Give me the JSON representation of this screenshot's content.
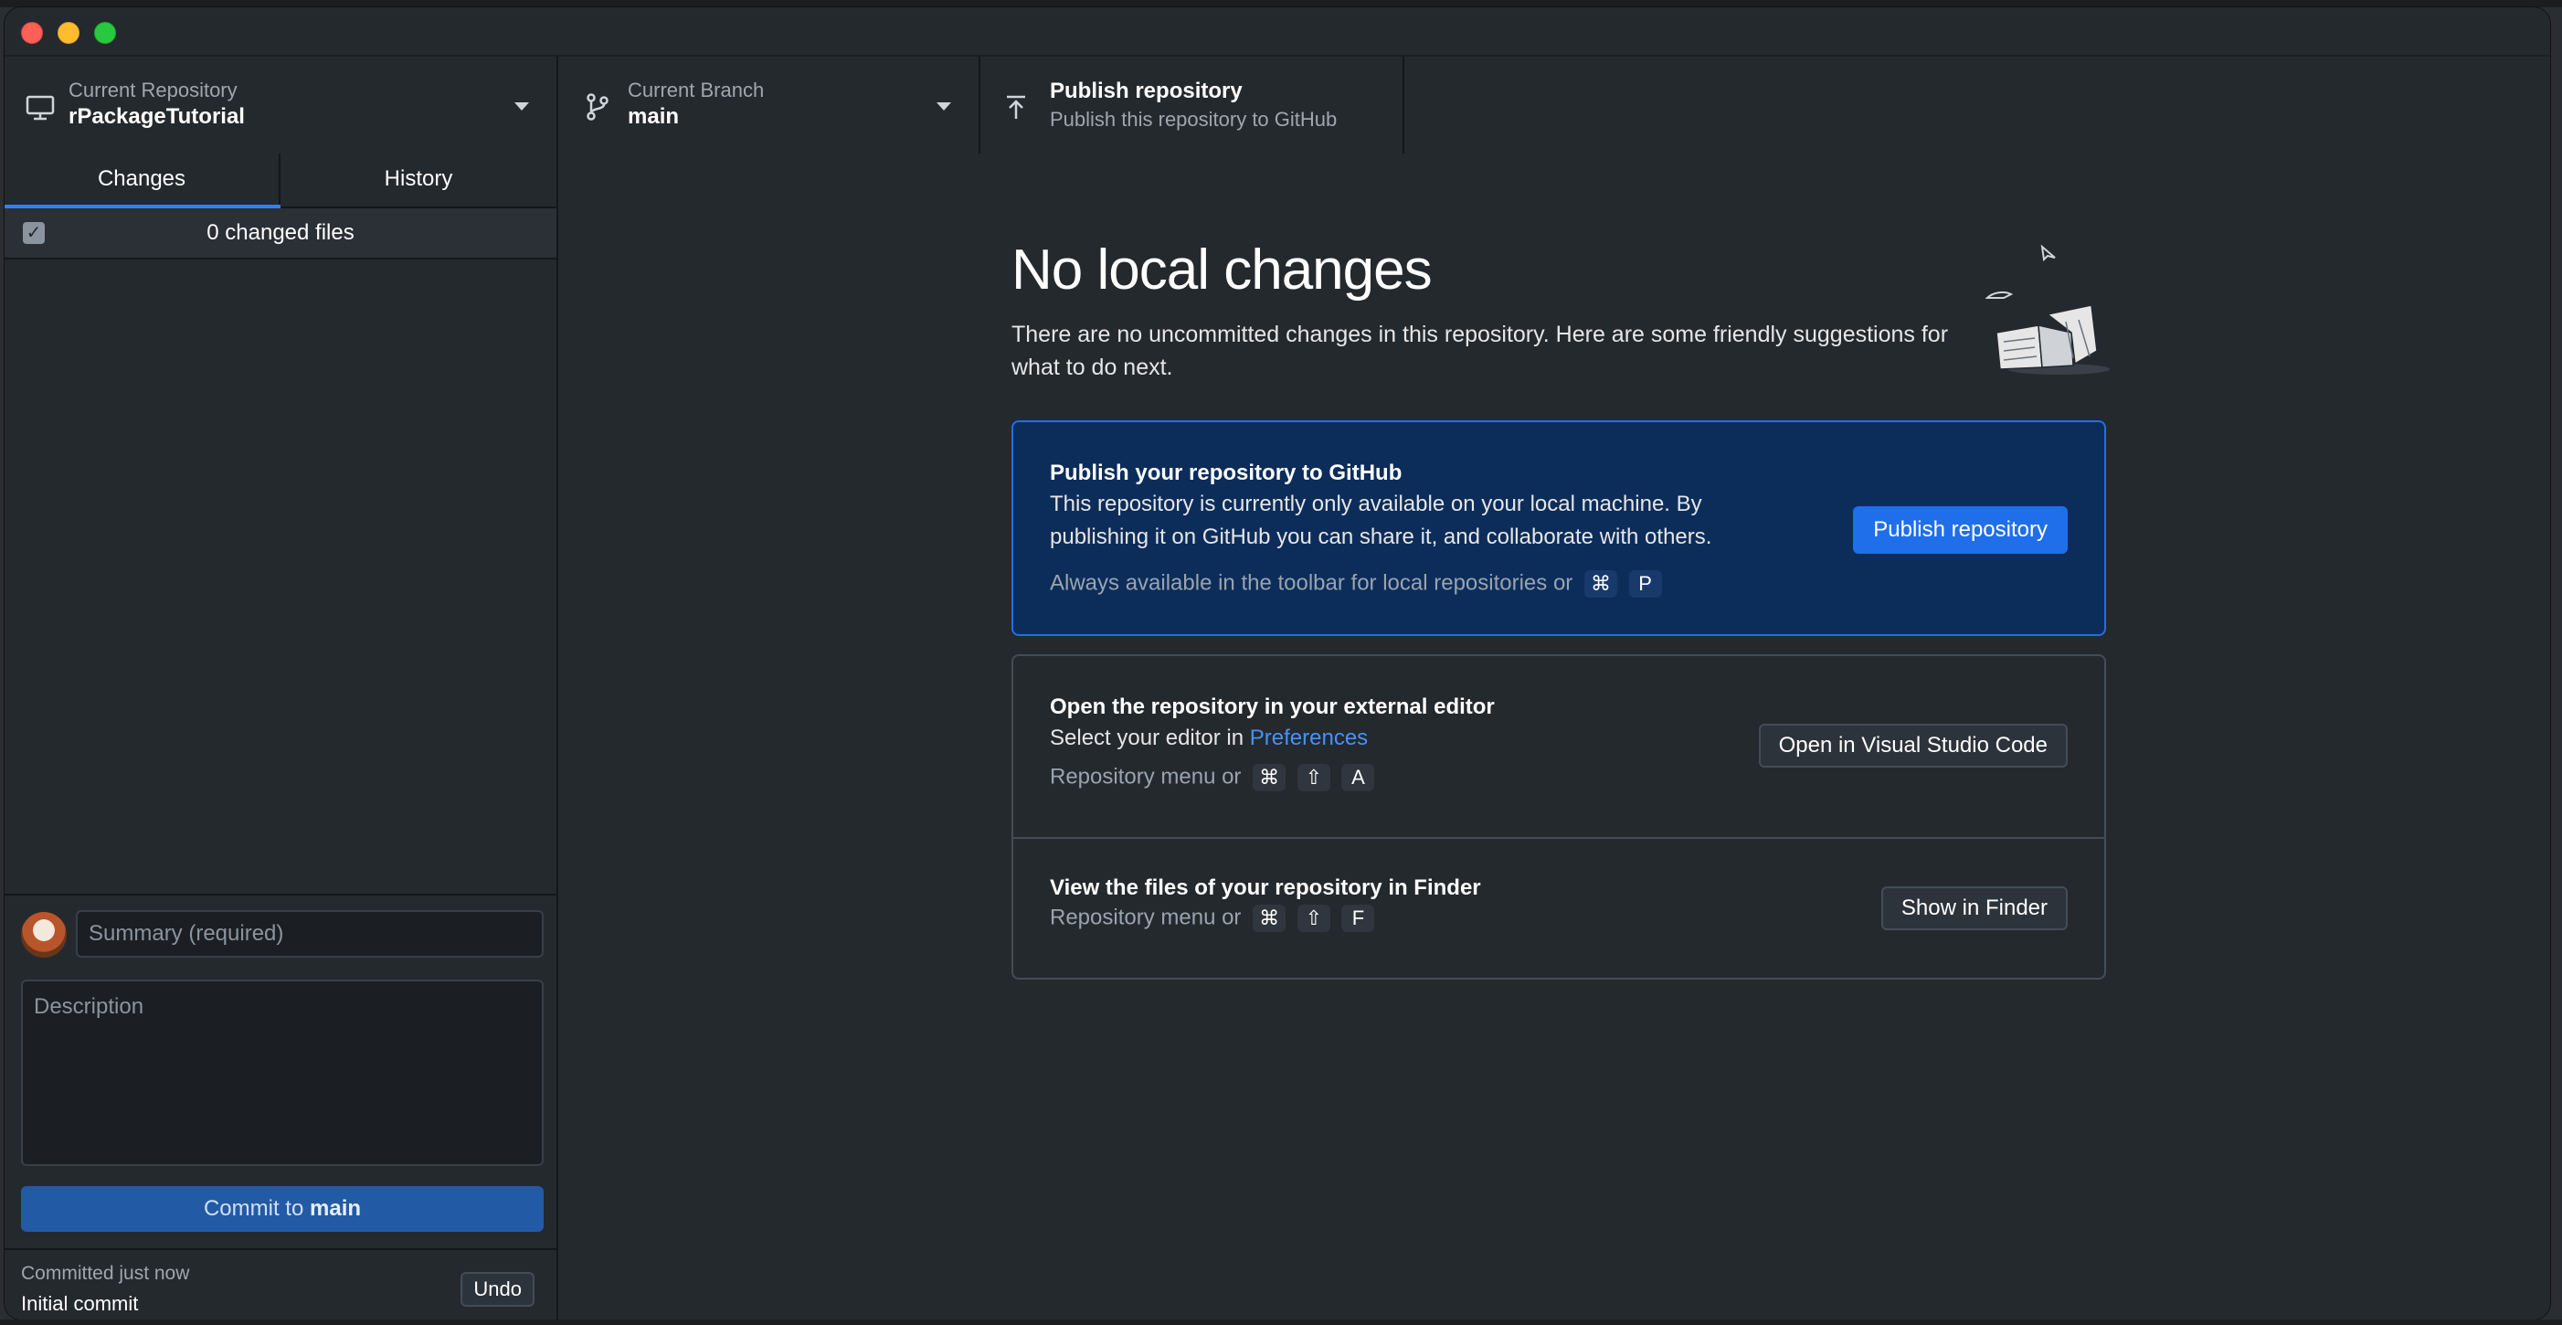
{
  "toolbar": {
    "repository": {
      "label": "Current Repository",
      "name": "rPackageTutorial"
    },
    "branch": {
      "label": "Current Branch",
      "name": "main"
    },
    "publish": {
      "title": "Publish repository",
      "subtitle": "Publish this repository to GitHub"
    }
  },
  "sidebar": {
    "tabs": [
      {
        "label": "Changes",
        "active": true
      },
      {
        "label": "History",
        "active": false
      }
    ],
    "changed_files": "0 changed files",
    "commit": {
      "summary_placeholder": "Summary (required)",
      "description_placeholder": "Description",
      "button_prefix": "Commit to",
      "button_branch": "main"
    },
    "last_commit": {
      "time": "Committed just now",
      "message": "Initial commit",
      "undo_label": "Undo"
    }
  },
  "main": {
    "title": "No local changes",
    "intro": "There are no uncommitted changes in this repository. Here are some friendly suggestions for what to do next.",
    "publish_card": {
      "title": "Publish your repository to GitHub",
      "text": "This repository is currently only available on your local machine. By publishing it on GitHub you can share it, and collaborate with others.",
      "hint": "Always available in the toolbar for local repositories or",
      "keys": [
        "⌘",
        "P"
      ],
      "button": "Publish repository"
    },
    "editor_card": {
      "title": "Open the repository in your external editor",
      "text_prefix": "Select your editor in",
      "link": "Preferences",
      "hint": "Repository menu or",
      "keys": [
        "⌘",
        "⇧",
        "A"
      ],
      "button": "Open in Visual Studio Code"
    },
    "finder_card": {
      "title": "View the files of your repository in Finder",
      "hint": "Repository menu or",
      "keys": [
        "⌘",
        "⇧",
        "F"
      ],
      "button": "Show in Finder"
    }
  },
  "colors": {
    "accent": "#1f6feb",
    "background": "#24292e",
    "publish_card_bg": "#0c2d5a"
  }
}
